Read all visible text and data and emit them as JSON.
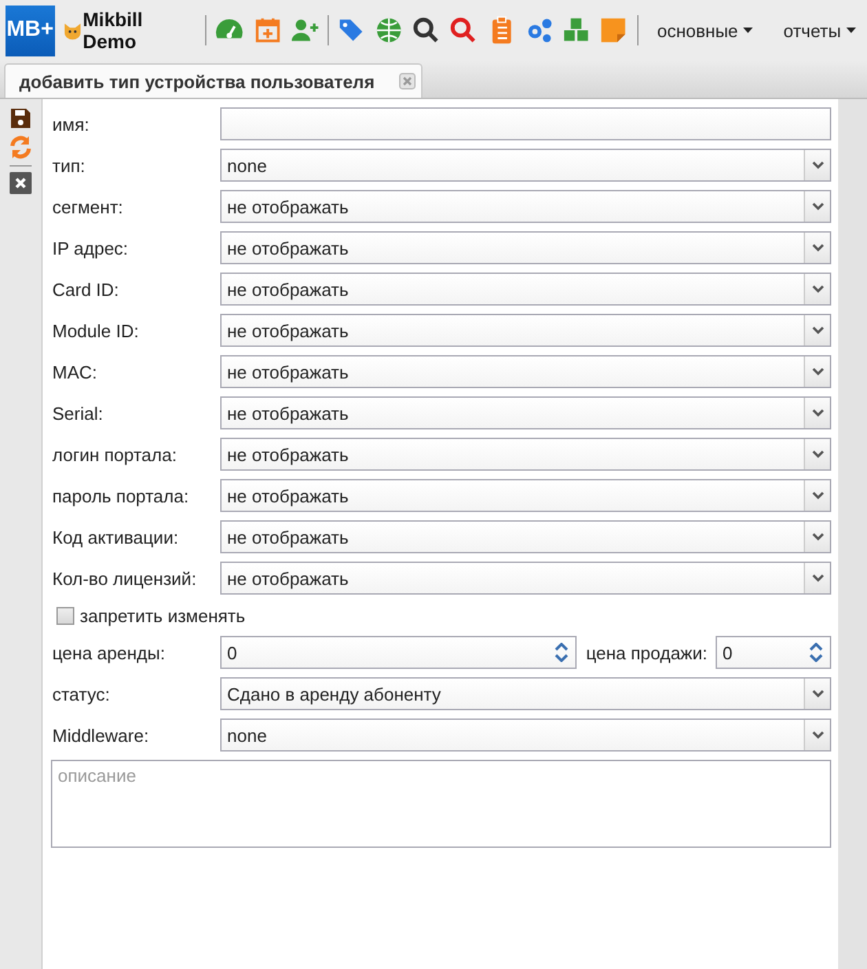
{
  "toolbar": {
    "logo": "MB+",
    "brand": "Mikbill Demo",
    "menus": [
      {
        "label": "основные"
      },
      {
        "label": "отчеты"
      }
    ]
  },
  "tabs": [
    {
      "label": "добавить тип устройства пользователя",
      "selected": true
    }
  ],
  "form": {
    "sections": [
      {
        "rows": [
          {
            "kind": "text",
            "label": "имя:"
          },
          {
            "kind": "select",
            "label": "тип:",
            "value": "none"
          },
          {
            "kind": "select",
            "label": "сегмент:",
            "value": "не отображать"
          },
          {
            "kind": "select",
            "label": "IP адрес:",
            "value": "не отображать"
          },
          {
            "kind": "select",
            "label": "Card ID:",
            "value": "не отображать"
          },
          {
            "kind": "select",
            "label": "Module ID:",
            "value": "не отображать"
          },
          {
            "kind": "select",
            "label": "MAC:",
            "value": "не отображать"
          },
          {
            "kind": "select",
            "label": "Serial:",
            "value": "не отображать"
          },
          {
            "kind": "select",
            "label": "логин портала:",
            "value": "не отображать"
          }
        ]
      },
      {
        "rows": [
          {
            "kind": "select",
            "label": "пароль портала:",
            "value": "не отображать"
          },
          {
            "kind": "select",
            "label": "Код активации:",
            "value": "не отображать"
          },
          {
            "kind": "select",
            "label": "Кол-во лицензий:",
            "value": "не отображать"
          }
        ]
      },
      {
        "rows": [
          {
            "kind": "checkbox",
            "label": "запретить изменять",
            "checked": false
          }
        ]
      },
      {
        "rows": [
          {
            "kind": "spinners",
            "label": "цена аренды:",
            "value": "0",
            "label_2": "цена продажи:",
            "value_2": "0"
          },
          {
            "kind": "select",
            "label": "статус:",
            "value": "Сдано в аренду абоненту"
          },
          {
            "kind": "select",
            "label": "Middleware:",
            "value": "none"
          },
          {
            "kind": "textarea",
            "placeholder": "описание"
          }
        ]
      }
    ]
  }
}
